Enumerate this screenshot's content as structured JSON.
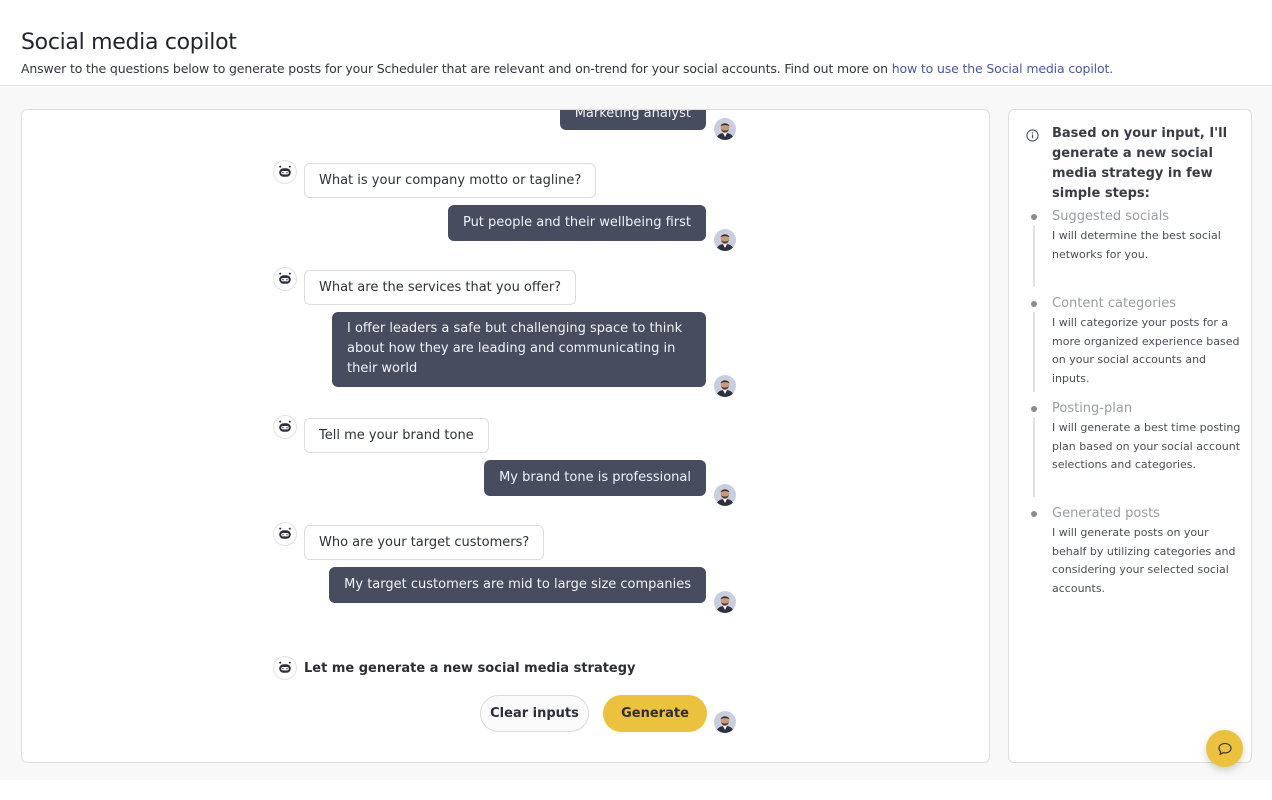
{
  "header": {
    "title": "Social media copilot",
    "subtitle": "Answer to the questions below to generate posts for your Scheduler that are relevant and on-trend for your social accounts. Find out more on ",
    "link_text": "how to use the Social media copilot."
  },
  "chat": {
    "messages": [
      {
        "role": "user",
        "text": "Marketing analyst"
      },
      {
        "role": "bot",
        "text": "What is your company motto or tagline?"
      },
      {
        "role": "user",
        "text": "Put people and their wellbeing first"
      },
      {
        "role": "bot",
        "text": "What are the services that you offer?"
      },
      {
        "role": "user",
        "text": "I offer leaders a safe but challenging space to think about how they are leading and communicating in their world"
      },
      {
        "role": "bot",
        "text": "Tell me your brand tone"
      },
      {
        "role": "user",
        "text": "My brand tone is professional"
      },
      {
        "role": "bot",
        "text": "Who are your target customers?"
      },
      {
        "role": "user",
        "text": "My target customers are mid to large size companies"
      }
    ],
    "final_prompt": "Let me generate a new social media strategy",
    "clear_label": "Clear inputs",
    "generate_label": "Generate"
  },
  "sidebar": {
    "intro": "Based on your input, I'll generate a new social media strategy in few simple steps:",
    "steps": [
      {
        "title": "Suggested socials",
        "desc": "I will determine the best social networks for you."
      },
      {
        "title": "Content categories",
        "desc": "I will categorize your posts for a more organized experience based on your social accounts and inputs."
      },
      {
        "title": "Posting-plan",
        "desc": "I will generate a best time posting plan based on your social account selections and categories."
      },
      {
        "title": "Generated posts",
        "desc": "I will generate posts on your behalf by utilizing categories and considering your selected social accounts."
      }
    ]
  },
  "colors": {
    "accent": "#ecc13c",
    "user_bubble": "#474c5e",
    "link": "#4658ac"
  },
  "icons": {
    "bot": "robot-icon",
    "user": "user-avatar",
    "info": "info-icon",
    "fab": "chat-bubble-icon"
  }
}
